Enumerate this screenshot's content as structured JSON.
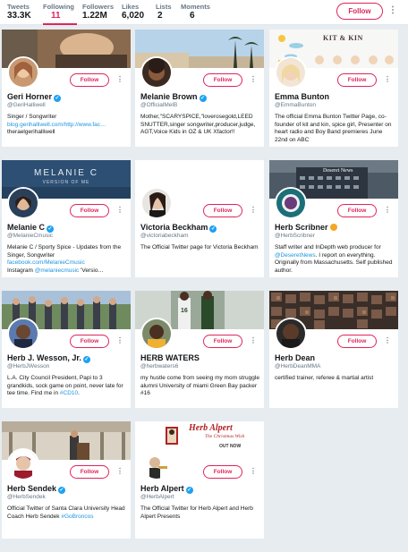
{
  "stats": [
    {
      "label": "Tweets",
      "value": "33.3K"
    },
    {
      "label": "Following",
      "value": "11"
    },
    {
      "label": "Followers",
      "value": "1.22M"
    },
    {
      "label": "Likes",
      "value": "6,020"
    },
    {
      "label": "Lists",
      "value": "2"
    },
    {
      "label": "Moments",
      "value": "6"
    }
  ],
  "header": {
    "follow_label": "Follow",
    "more_label": "⋮"
  },
  "cards": [
    {
      "name": "Geri Horner",
      "handle": "@GeriHalliwell",
      "follow": "Follow",
      "bio1": "Singer / Songwriter",
      "bio_link": "blog.gerihalliwell.com/http://www.fac…",
      "bio3": "theraelgerihalliwell"
    },
    {
      "name": "Melanie Brown",
      "handle": "@OfficialMelB",
      "follow": "Follow",
      "bio1": "Mother,\"SCARYSPICE,\"loverosegold,LEED SNUTTER,singer songwriter,producer,judge, AGT,Voice Kids in OZ & UK Xfactor!!"
    },
    {
      "name": "Emma Bunton",
      "handle": "@EmmaBunton",
      "follow": "Follow",
      "bio1": "The official Emma Bunton Twitter Page, co-founder of kit and kin, spice girl, Presenter on heart radio and Boy Band premieres June 22nd on ABC",
      "banner_text": "KIT & KIN"
    },
    {
      "name": "Melanie C",
      "handle": "@MelanieCmusic",
      "follow": "Follow",
      "bio1": "Melanie C / Sporty Spice - Updates from the Singer, Songwriter",
      "bio_link": "facebook.com/MelanieCmusic",
      "bio3": "Instagram",
      "bio_link2": "@melaniecmusic",
      "bio4": "'Versio…",
      "banner_text": "MELANIE C",
      "banner_sub": "VERSION OF ME"
    },
    {
      "name": "Victoria Beckham",
      "handle": "@victoriabeckham",
      "follow": "Follow",
      "bio1": "The Official Twitter page for Victoria Beckham"
    },
    {
      "name": "Herb Scribner",
      "handle": "@HerbScribner",
      "follow": "Follow",
      "bio1": "Staff writer and InDepth web producer for",
      "bio_link": "@DeseretNews",
      "bio3": ". I report on everything. Originally from Massachusetts. Self published author.",
      "banner_text": "Deseret News"
    },
    {
      "name": "Herb J. Wesson, Jr.",
      "handle": "@HerbJWesson",
      "follow": "Follow",
      "bio1": "L.A. City Council President, Papi to 3 grandkids, sock game on point, never late for tee time. Find me in",
      "bio_link": "#CD10",
      "bio3": "."
    },
    {
      "name": "HERB WATERS",
      "handle": "@herbwaters6",
      "follow": "Follow",
      "bio1": "my hustle come from seeing my mom struggle alumni University of miami Green Bay packer #16"
    },
    {
      "name": "Herb Dean",
      "handle": "@HerbDeanMMA",
      "follow": "Follow",
      "bio1": "certified trainer, referee & martial artist"
    },
    {
      "name": "Herb Sendek",
      "handle": "@HerbSendek",
      "follow": "Follow",
      "bio1": "Official Twitter of Santa Clara University Head Coach Herb Sendek",
      "bio_link": "#GoBroncos"
    },
    {
      "name": "Herb Alpert",
      "handle": "@HerbAlpert",
      "follow": "Follow",
      "bio1": "The Official Twitter for Herb Alpert and Herb Alpert Presents",
      "banner_text": "Herb Alpert",
      "banner_sub": "The Christmas Wish",
      "banner_sub2": "OUT NOW"
    }
  ]
}
